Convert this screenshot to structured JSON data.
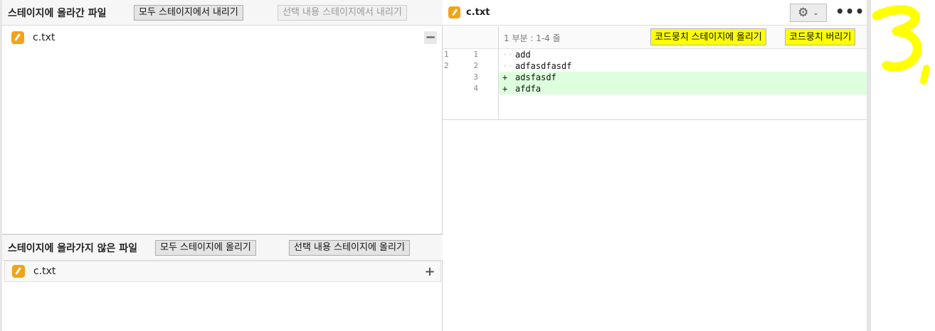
{
  "staged": {
    "title": "스테이지에 올라간 파일",
    "unstage_all_label": "모두 스테이지에서 내리기",
    "unstage_selected_label": "선택 내용 스테이지에서 내리기",
    "files": [
      {
        "name": "c.txt",
        "action": "−"
      }
    ]
  },
  "unstaged": {
    "title": "스테이지에 올라가지 않은 파일",
    "stage_all_label": "모두 스테이지에 올리기",
    "stage_selected_label": "선택 내용 스테이지에 올리기",
    "files": [
      {
        "name": "c.txt",
        "action": "+"
      }
    ]
  },
  "diff": {
    "file_name": "c.txt",
    "gear_icon": "⚙",
    "chevron_icon": "⌄",
    "more_icon": "•••",
    "hunk_label": "1 부분 : 1-4 줄",
    "stage_hunk_label": "코드뭉치 스테이지에 올리기",
    "discard_hunk_label": "코드뭉치 버리기",
    "lines": [
      {
        "old": "1",
        "new": "1",
        "marker": "··",
        "text": "add",
        "type": "context"
      },
      {
        "old": "2",
        "new": "2",
        "marker": "··",
        "text": "adfasdfasdf",
        "type": "context"
      },
      {
        "old": "",
        "new": "3",
        "marker": "+",
        "text": "adsfasdf",
        "type": "added"
      },
      {
        "old": "",
        "new": "4",
        "marker": "+",
        "text": "afdfa",
        "type": "added"
      }
    ]
  },
  "colors": {
    "file_icon": "#f3a316",
    "added_bg": "#ddffdd",
    "annotation": "#ffff00"
  }
}
